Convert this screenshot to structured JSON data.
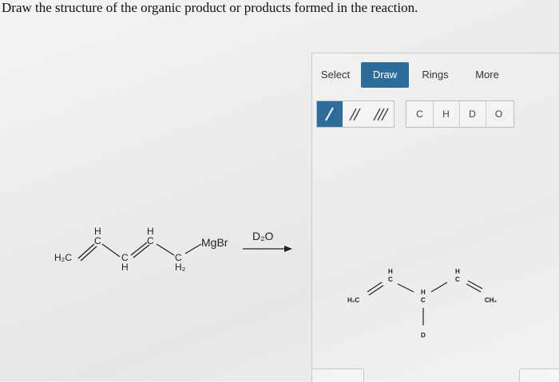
{
  "question": "Draw the structure of the organic product or products formed in the reaction.",
  "toolbar": {
    "tabs": [
      {
        "label": "Select"
      },
      {
        "label": "Draw",
        "active": true
      },
      {
        "label": "Rings"
      },
      {
        "label": "More"
      }
    ],
    "bond_tools": [
      "single-bond",
      "double-bond",
      "triple-bond"
    ],
    "atoms": [
      "C",
      "H",
      "D",
      "O"
    ],
    "accent_color": "#2e6d9a"
  },
  "reactant": {
    "h2c": "H₂C",
    "h_top1": "H",
    "c_top1": "C",
    "c_bot1": "C",
    "h_bot1": "H",
    "h_top2": "H",
    "c_top2": "C",
    "c_bot2": "C",
    "h2_bot2": "H₂",
    "mgbr": "MgBr"
  },
  "reagent": {
    "label": "D₂O"
  },
  "product": {
    "h2c": "H₂C",
    "h1": "H",
    "c1": "C",
    "h2": "H",
    "c2": "C",
    "h3": "H",
    "c3": "C",
    "ch2": "CH₂",
    "d": "D"
  }
}
